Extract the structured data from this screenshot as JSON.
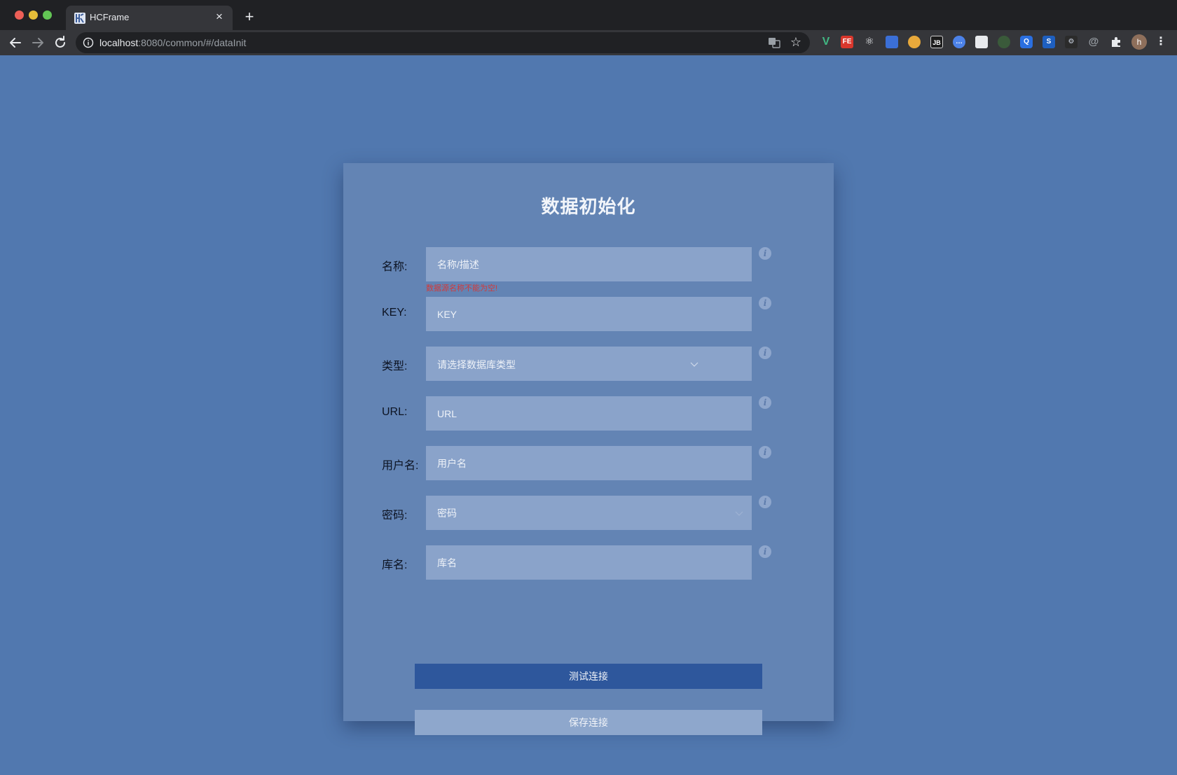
{
  "browser": {
    "tab_title": "HCFrame",
    "new_tab_symbol": "+",
    "close_symbol": "×",
    "url_host": "localhost",
    "url_rest": ":8080/common/#/dataInit",
    "extension_icons": [
      "vue-devtools",
      "fe-helper",
      "react-devtools",
      "bookmark-ext",
      "color-ext",
      "jetbrains",
      "chat-ext",
      "mail-ext",
      "ext-green",
      "ext-blue-q",
      "ext-s",
      "ext-gear",
      "ext-at",
      "puzzle"
    ],
    "profile_initial": "h"
  },
  "form": {
    "title": "数据初始化",
    "fields": {
      "name": {
        "label": "名称:",
        "placeholder": "名称/描述",
        "error": "数据源名称不能为空!"
      },
      "key": {
        "label": "KEY:",
        "placeholder": "KEY"
      },
      "type": {
        "label": "类型:",
        "placeholder": "请选择数据库类型"
      },
      "url": {
        "label": "URL:",
        "placeholder": "URL"
      },
      "username": {
        "label": "用户名:",
        "placeholder": "用户名"
      },
      "password": {
        "label": "密码:",
        "placeholder": "密码"
      },
      "dbname": {
        "label": "库名:",
        "placeholder": "库名"
      }
    },
    "info_symbol": "i",
    "buttons": {
      "test": "测试连接",
      "save": "保存连接"
    }
  },
  "colors": {
    "page_bg": "#5178af",
    "card_bg": "#6384b4",
    "input_bg": "#8aa3ca",
    "primary_button": "#2e579c",
    "secondary_button": "#8ea7cc",
    "error": "#d23a3a"
  }
}
